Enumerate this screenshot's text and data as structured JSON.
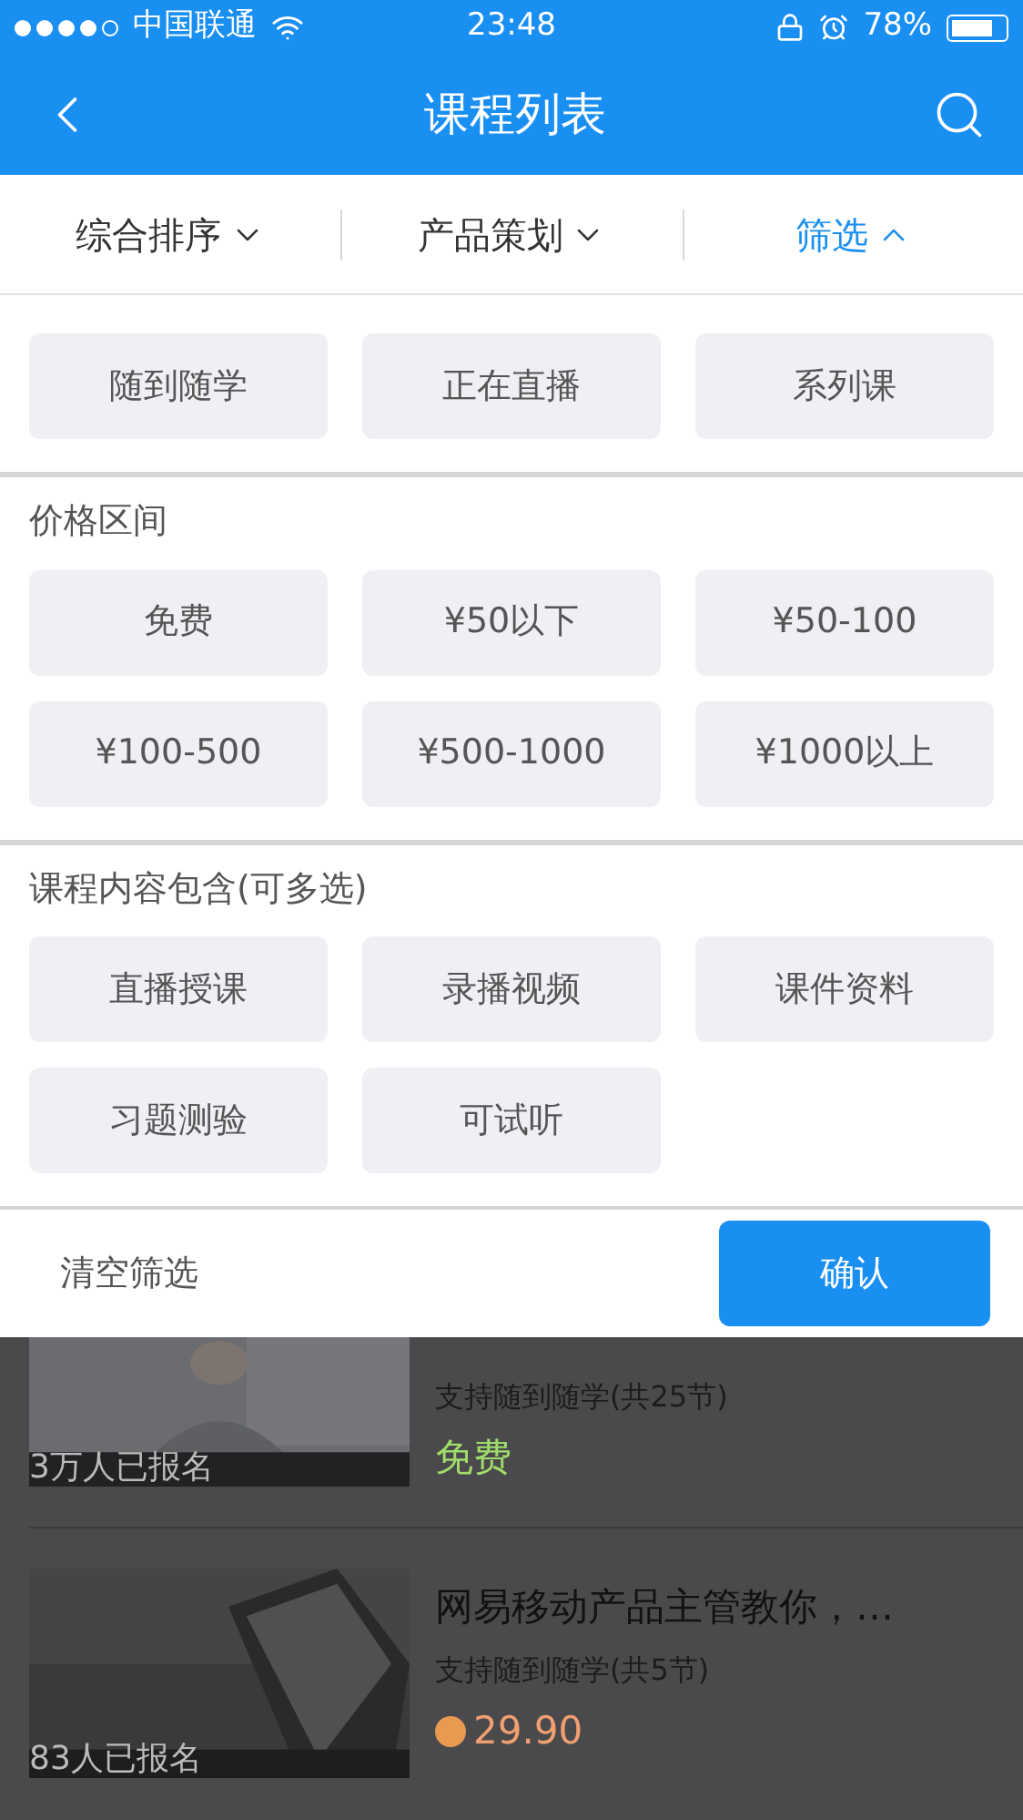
{
  "status_bar": {
    "carrier": "中国联通",
    "time": "23:48",
    "battery": "78%"
  },
  "nav": {
    "title": "课程列表"
  },
  "sort_tabs": [
    {
      "label": "综合排序",
      "selected": false,
      "expanded": false
    },
    {
      "label": "产品策划",
      "selected": false,
      "expanded": false
    },
    {
      "label": "筛选",
      "selected": true,
      "expanded": true
    }
  ],
  "filter_groups": [
    {
      "options": [
        {
          "label": "随到随学",
          "selected": false
        },
        {
          "label": "正在直播",
          "selected": false
        },
        {
          "label": "系列课",
          "selected": false
        }
      ]
    },
    {
      "title": "价格区间",
      "options": [
        {
          "label": "免费",
          "selected": false
        },
        {
          "label": "¥50以下",
          "selected": false
        },
        {
          "label": "¥50-100",
          "selected": false
        },
        {
          "label": "¥100-500",
          "selected": false
        },
        {
          "label": "¥500-1000",
          "selected": false
        },
        {
          "label": "¥1000以上",
          "selected": false
        }
      ]
    },
    {
      "title": "课程内容包含(可多选)",
      "options": [
        {
          "label": "直播授课",
          "selected": false
        },
        {
          "label": "录播视频",
          "selected": false
        },
        {
          "label": "课件资料",
          "selected": false
        },
        {
          "label": "习题测验",
          "selected": false
        },
        {
          "label": "可试听",
          "selected": false
        }
      ]
    }
  ],
  "actions": {
    "clear": "清空筛选",
    "confirm": "确认"
  },
  "courses": [
    {
      "enrolled": "3万人已报名",
      "subtitle": "支持随到随学(共25节)",
      "price": "免费",
      "kind": "free"
    },
    {
      "title": "网易移动产品主管教你，…",
      "enrolled": "83人已报名",
      "subtitle": "支持随到随学(共5节)",
      "price": "29.90",
      "kind": "paid"
    }
  ]
}
